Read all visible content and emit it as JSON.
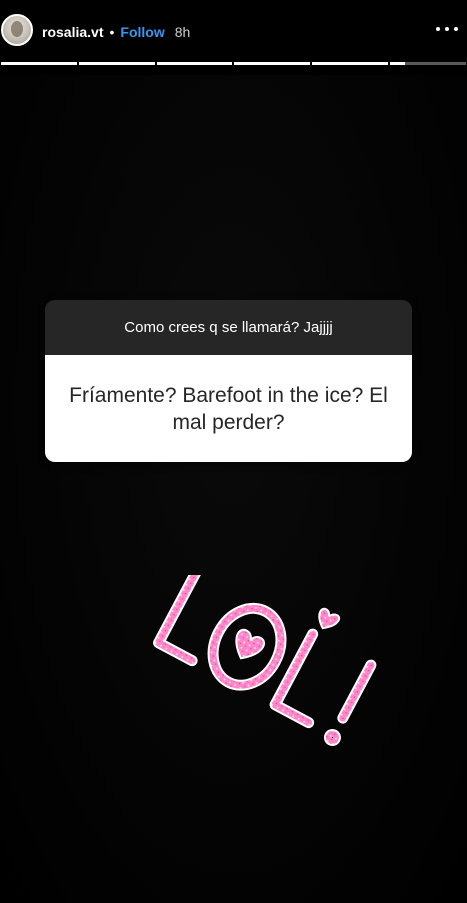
{
  "header": {
    "username": "rosalia.vt",
    "separator": "•",
    "follow_label": "Follow",
    "time": "8h",
    "menu_icon": "more-horizontal-icon"
  },
  "progress": {
    "segments_total": 6,
    "segments_done": 5,
    "current_segment_fraction": 0.2
  },
  "question_sticker": {
    "question": "Como crees q se llamará? Jajjjj",
    "answer": "Fríamente? Barefoot in the ice? El mal perder?"
  },
  "lol_sticker": {
    "text": "LOL!",
    "icon": "lol-glitter-sticker-icon",
    "color": "#ff8fcf"
  },
  "colors": {
    "follow": "#3897f0",
    "question_header_bg": "#262626",
    "answer_bg": "#ffffff"
  }
}
